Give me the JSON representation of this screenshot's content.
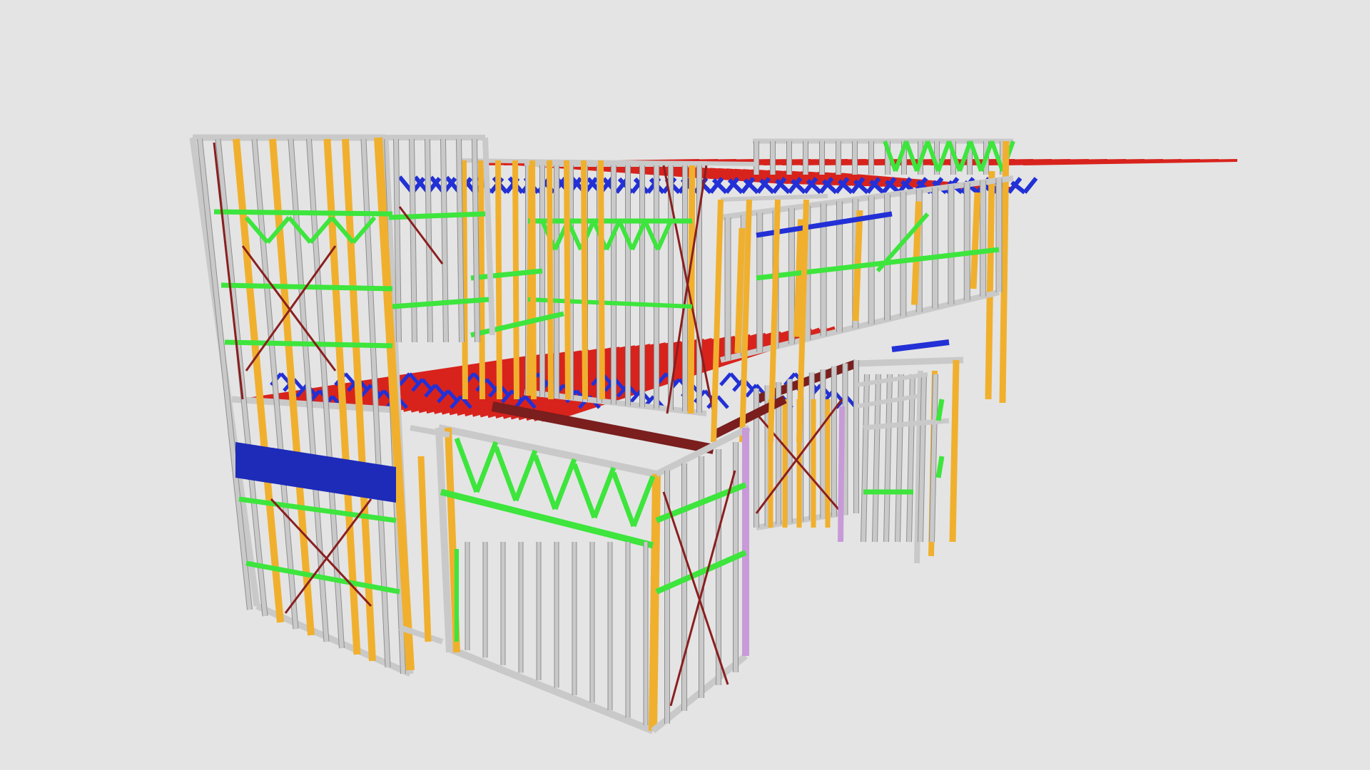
{
  "viewer": {
    "background": "#e4e4e4"
  },
  "model": {
    "kind": "steel-frame-building",
    "member_colors": {
      "stud": "#c9c9c9",
      "stud_edge": "#8f8f8f",
      "jamb": "#f0b02e",
      "nogging": "#3de53d",
      "joist": "#d8231d",
      "truss_web": "#2230d6",
      "lintel": "#1d2bb8",
      "bracing": "#8a1f1f",
      "beam": "#7a1e1e",
      "post": "#c89ad8"
    }
  }
}
